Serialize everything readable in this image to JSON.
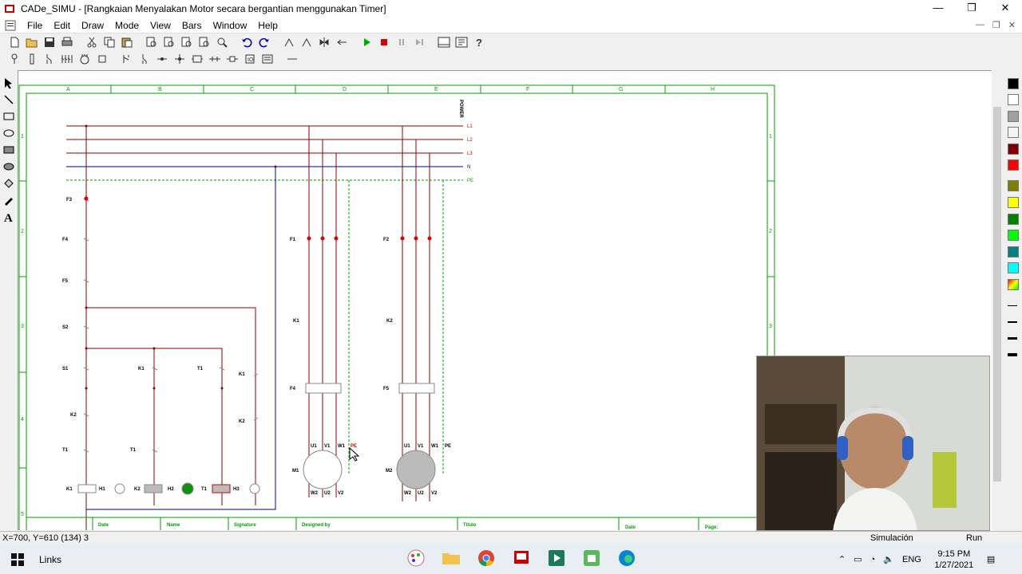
{
  "window": {
    "title": "CADe_SIMU - [Rangkaian Menyalakan Motor secara bergantian menggunakan Timer]",
    "minimize": "—",
    "restore": "❐",
    "close": "✕"
  },
  "menu": [
    "File",
    "Edit",
    "Draw",
    "Mode",
    "View",
    "Bars",
    "Window",
    "Help"
  ],
  "toolbar1": [
    "new-icon",
    "open-icon",
    "save-icon",
    "print-icon",
    "cut-icon",
    "copy-icon",
    "paste-icon",
    "zoom-in-icon",
    "zoom-out-icon",
    "zoom-window-icon",
    "zoom-fit-icon",
    "zoom-prev-icon",
    "undo-icon",
    "redo-icon",
    "rotate-left-icon",
    "rotate-right-icon",
    "mirror-h-icon",
    "mirror-v-icon",
    "start-icon",
    "stop-icon",
    "pause-icon",
    "step-icon",
    "sheet-icon",
    "config-icon",
    "help-icon"
  ],
  "toolbar2": [
    "power-supply-icon",
    "fuse-icon",
    "switch-icon",
    "contacts-icon",
    "motor-icon",
    "coil-icon",
    "pushbutton-icon",
    "contact-no-icon",
    "terminal-icon",
    "connector-icon",
    "junction-icon",
    "relay-icon",
    "timer-icon",
    "plc-icon",
    "signal-icon",
    "wire-icon"
  ],
  "colors": {
    "accent": "#00a000",
    "wire_red": "#8b0000",
    "wire_blue": "#00008b",
    "contact_red": "#d00000"
  },
  "drawing": {
    "columns": [
      "A",
      "B",
      "C",
      "D",
      "E",
      "F",
      "G",
      "H"
    ],
    "rows": [
      "1",
      "2",
      "3",
      "4",
      "5"
    ],
    "power_label": "POWER",
    "bus": [
      "L1",
      "L2",
      "L3",
      "N",
      "PE"
    ],
    "labels": {
      "f3": "F3",
      "f4": "F4",
      "f5": "F5",
      "s2": "S2",
      "s1": "S1",
      "k1a": "K1",
      "t1a": "T1",
      "k1b": "K1",
      "k2a": "K2",
      "t1b": "T1",
      "t1c": "T1",
      "k2b": "K2",
      "f1": "F1",
      "f2": "F2",
      "k1m": "K1",
      "k2m": "K2",
      "f4m": "F4",
      "f5m": "F5",
      "m1": "M1",
      "m2": "M2"
    },
    "bottom_row": [
      "K1",
      "H1",
      "K2",
      "H2",
      "T1",
      "H3"
    ],
    "motor_terminals": [
      "U1",
      "V1",
      "W1",
      "PE",
      "W2",
      "U2",
      "V2"
    ],
    "title_block": [
      "Date",
      "Name",
      "Signature",
      "Designed by",
      "Título",
      "Date",
      "Page:"
    ]
  },
  "status": {
    "coords": "X=700, Y=610 (134) 3",
    "mode": "Simulación",
    "state": "Run"
  },
  "taskbar": {
    "links": "Links",
    "lang": "ENG",
    "time": "9:15 PM",
    "date": "1/27/2021"
  }
}
